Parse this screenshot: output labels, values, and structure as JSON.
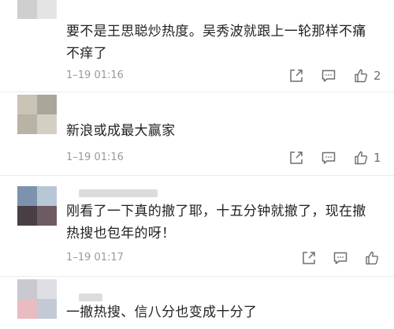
{
  "comments": [
    {
      "text_lines": [
        "要不是王思聪炒热度。吴秀波就跟上一轮那样不痛",
        "不痒了"
      ],
      "timestamp": "1–19 01:16",
      "likes": "2",
      "avatar_colors": [
        "#dcdcdc",
        "#ebebeb",
        "#cfcfcf",
        "#e4e4e4"
      ]
    },
    {
      "text_lines": [
        "新浪或成最大赢家"
      ],
      "timestamp": "1–19 01:16",
      "likes": "1",
      "avatar_colors": [
        "#c9c4b6",
        "#aaa69a",
        "#b8b3a5",
        "#d4cfc3"
      ]
    },
    {
      "text_lines": [
        "刚看了一下真的撤了耶，十五分钟就撤了，现在撤",
        "热搜也包年的呀！"
      ],
      "timestamp": "1–19 01:17",
      "likes": "",
      "avatar_colors": [
        "#7c93ad",
        "#b8c7d6",
        "#4a3e46",
        "#6e5a62"
      ]
    },
    {
      "text_lines": [
        "一撤热搜、信八分也变成十分了"
      ],
      "timestamp": "",
      "likes": "",
      "avatar_colors": [
        "#c9c9d2",
        "#dedee4",
        "#e9bcc2",
        "#c2cad6"
      ]
    }
  ],
  "icons": {
    "share": "share-icon",
    "comment": "comment-icon",
    "like": "thumbs-up-icon"
  },
  "colors": {
    "text": "#222222",
    "meta": "#9a9a9a",
    "icon": "#6f6f6f",
    "divider": "#ececec"
  }
}
